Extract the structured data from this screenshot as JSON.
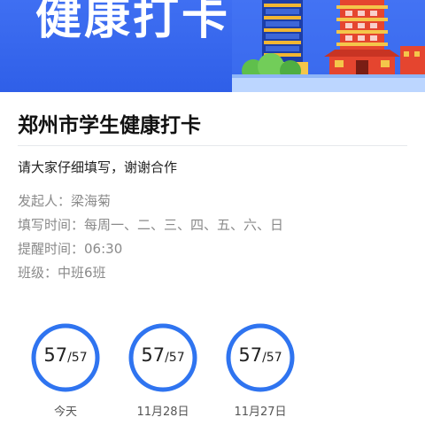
{
  "banner": {
    "title": "健康打卡",
    "bg_color": "#2f5fe8",
    "illustration": "city-tower-illustration"
  },
  "card": {
    "title": "郑州市学生健康打卡",
    "description": "请大家仔细填写，谢谢合作",
    "info": [
      {
        "label": "发起人：",
        "value": "梁海菊"
      },
      {
        "label": "填写时间：",
        "value": "每周一、二、三、四、五、六、日"
      },
      {
        "label": "提醒时间：",
        "value": "06:30"
      },
      {
        "label": "班级：",
        "value": "中班6班"
      }
    ]
  },
  "stats": [
    {
      "count": "57",
      "total": "/57",
      "date": "今天",
      "completion": 1.0
    },
    {
      "count": "57",
      "total": "/57",
      "date": "11月28日",
      "completion": 1.0
    },
    {
      "count": "57",
      "total": "/57",
      "date": "11月27日",
      "completion": 1.0
    }
  ],
  "colors": {
    "ring": "#2f74f0",
    "accent": "#2f5fe8"
  }
}
